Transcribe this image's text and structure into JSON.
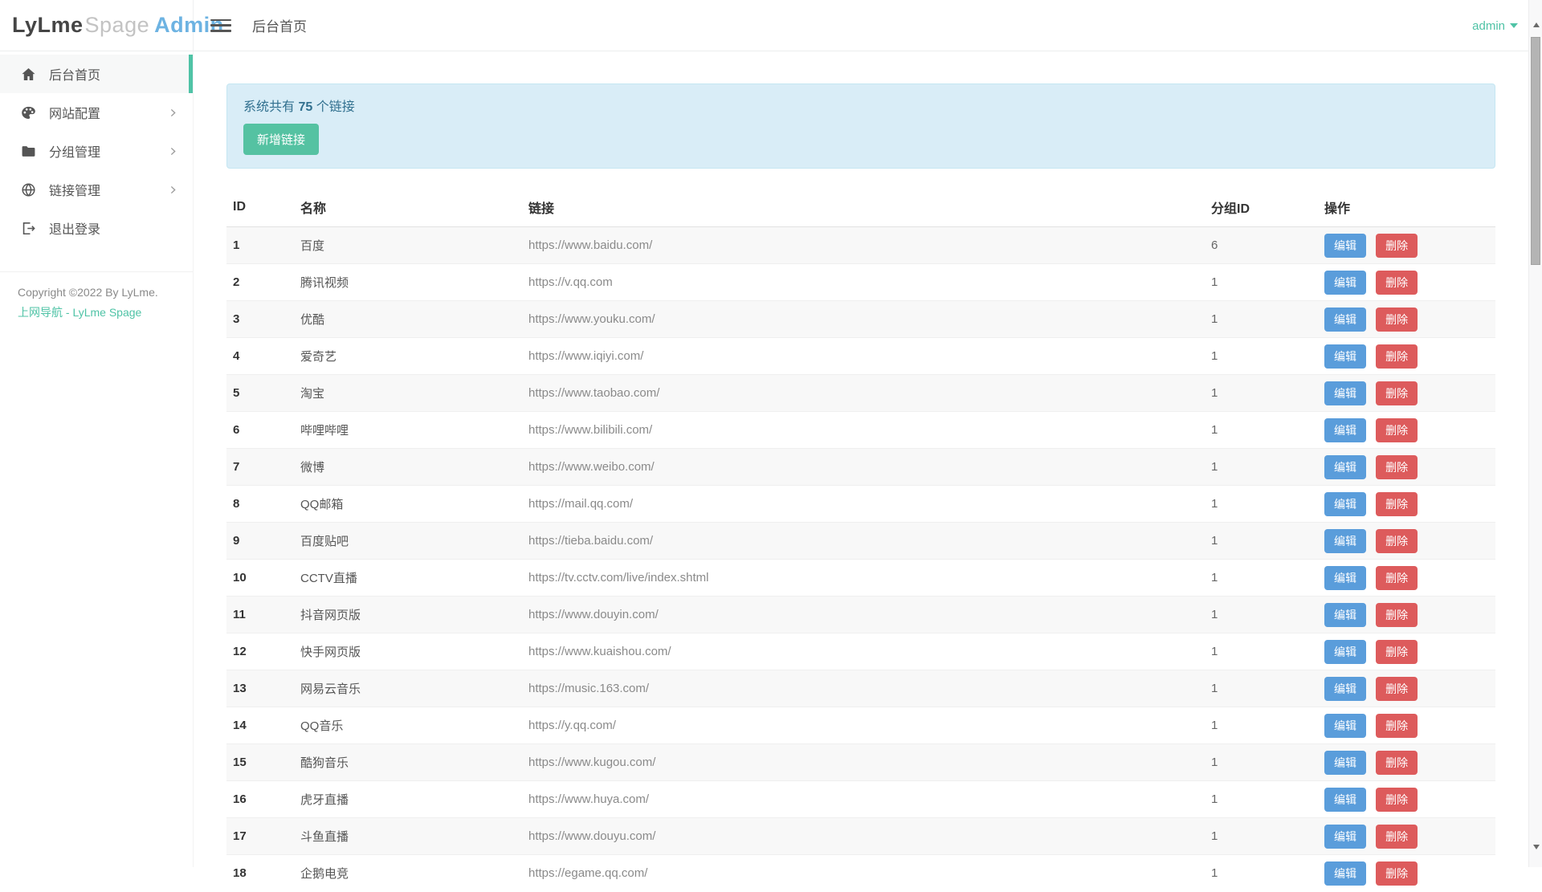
{
  "topbar": {
    "logo_part1": "LyLme",
    "logo_part2": "Spage",
    "logo_part3": "Admin",
    "page_title": "后台首页",
    "user_menu": "admin"
  },
  "sidebar": {
    "items": [
      {
        "label": "后台首页",
        "icon": "home-icon",
        "active": true
      },
      {
        "label": "网站配置",
        "icon": "palette-icon",
        "active": false
      },
      {
        "label": "分组管理",
        "icon": "folder-icon",
        "active": false
      },
      {
        "label": "链接管理",
        "icon": "globe-icon",
        "active": false
      },
      {
        "label": "退出登录",
        "icon": "logout-icon",
        "active": false
      }
    ],
    "copyright": "Copyright ©2022 By LyLme.",
    "footer_link_1": "上网导航",
    "footer_sep": " - ",
    "footer_link_2": "LyLme Spage"
  },
  "alert": {
    "text_prefix": "系统共有 ",
    "count": "75",
    "text_suffix": " 个链接",
    "add_button": "新增链接"
  },
  "table": {
    "headers": [
      "ID",
      "名称",
      "链接",
      "分组ID",
      "操作"
    ],
    "edit_label": "编辑",
    "delete_label": "删除",
    "rows": [
      {
        "id": "1",
        "name": "百度",
        "url": "https://www.baidu.com/",
        "group": "6"
      },
      {
        "id": "2",
        "name": "腾讯视频",
        "url": "https://v.qq.com",
        "group": "1"
      },
      {
        "id": "3",
        "name": "优酷",
        "url": "https://www.youku.com/",
        "group": "1"
      },
      {
        "id": "4",
        "name": "爱奇艺",
        "url": "https://www.iqiyi.com/",
        "group": "1"
      },
      {
        "id": "5",
        "name": "淘宝",
        "url": "https://www.taobao.com/",
        "group": "1"
      },
      {
        "id": "6",
        "name": "哔哩哔哩",
        "url": "https://www.bilibili.com/",
        "group": "1"
      },
      {
        "id": "7",
        "name": "微博",
        "url": "https://www.weibo.com/",
        "group": "1"
      },
      {
        "id": "8",
        "name": "QQ邮箱",
        "url": "https://mail.qq.com/",
        "group": "1"
      },
      {
        "id": "9",
        "name": "百度贴吧",
        "url": "https://tieba.baidu.com/",
        "group": "1"
      },
      {
        "id": "10",
        "name": "CCTV直播",
        "url": "https://tv.cctv.com/live/index.shtml",
        "group": "1"
      },
      {
        "id": "11",
        "name": "抖音网页版",
        "url": "https://www.douyin.com/",
        "group": "1"
      },
      {
        "id": "12",
        "name": "快手网页版",
        "url": "https://www.kuaishou.com/",
        "group": "1"
      },
      {
        "id": "13",
        "name": "网易云音乐",
        "url": "https://music.163.com/",
        "group": "1"
      },
      {
        "id": "14",
        "name": "QQ音乐",
        "url": "https://y.qq.com/",
        "group": "1"
      },
      {
        "id": "15",
        "name": "酷狗音乐",
        "url": "https://www.kugou.com/",
        "group": "1"
      },
      {
        "id": "16",
        "name": "虎牙直播",
        "url": "https://www.huya.com/",
        "group": "1"
      },
      {
        "id": "17",
        "name": "斗鱼直播",
        "url": "https://www.douyu.com/",
        "group": "1"
      },
      {
        "id": "18",
        "name": "企鹅电竞",
        "url": "https://egame.qq.com/",
        "group": "1"
      }
    ]
  },
  "colors": {
    "accent_teal": "#4fc3a6",
    "add_button_green": "#55c2a2",
    "edit_blue": "#5a9ddb",
    "delete_red": "#dd5b5c",
    "alert_bg": "#d9edf7",
    "alert_text": "#31708f",
    "logo_blue": "#6db3e2"
  }
}
